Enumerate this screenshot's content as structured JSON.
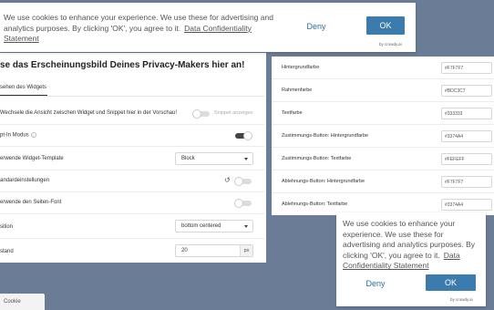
{
  "left_panel": {
    "title": "se das Erscheinungsbild Deines Privacy-Makers hier an!",
    "tab": "sehen des Widgets",
    "rows": [
      {
        "label": "Wechsele die Ansicht zwischen Widget und Snippet hier in der Vorschau!",
        "hint": "Snippet anzeigen",
        "control": "toggle-off"
      },
      {
        "label": "pt-In Modus",
        "control": "toggle-on"
      },
      {
        "label": "erwende Widget-Template",
        "control": "select",
        "value": "Block"
      },
      {
        "label": "andardeinstellungen",
        "control": "toggle-off-reset"
      },
      {
        "label": "erwende den Seiten-Font",
        "control": "toggle-off"
      },
      {
        "label": "sition",
        "control": "select",
        "value": "bottom centered"
      },
      {
        "label": "stand",
        "control": "number",
        "value": "20",
        "unit": "px"
      }
    ]
  },
  "right_panel": {
    "rows": [
      {
        "label": "Hintergrundfarbe",
        "value": "#F7F7F7"
      },
      {
        "label": "Rahmenfarbe",
        "value": "#BDC3C7"
      },
      {
        "label": "Textfarbe",
        "value": "#333333"
      },
      {
        "label": "Zustimmungs-Button: Hintergrundfarbe",
        "value": "#3374A4"
      },
      {
        "label": "Zustimmungs-Button: Textfarbe",
        "value": "#FEFEFF"
      },
      {
        "label": "Ablehnungs-Button: Hintergrundfarbe",
        "value": "#F7F7F7"
      },
      {
        "label": "Ablehnungs-Button: Textfarbe",
        "value": "#3374A4"
      }
    ]
  },
  "banner_top": {
    "text": "We use cookies to enhance your experience. We use these for advertising and analytics purposes. By clicking 'OK', you agree to it.",
    "link": "Data Confidentiality Statement",
    "deny": "Deny",
    "ok": "OK",
    "by": "by crowdy.ai"
  },
  "banner_br": {
    "text": "We use cookies to enhance your experience. We use these for advertising and analytics purposes. By clicking 'OK', you agree to it.",
    "link": "Data Confidentiality Statement",
    "deny": "Deny",
    "ok": "OK",
    "by": "by crowdy.ai"
  },
  "cookie_tab": "Cookie",
  "colors": {
    "accent": "#3b7bad",
    "background": "#6b7c96"
  }
}
